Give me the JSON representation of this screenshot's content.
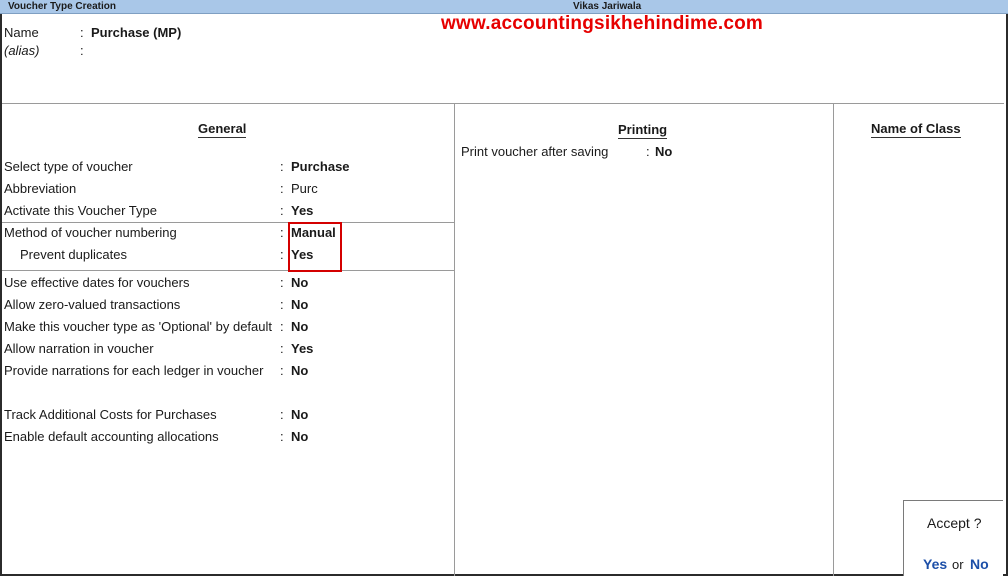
{
  "window": {
    "title": "Voucher Type Creation",
    "company": "Vikas Jariwala"
  },
  "watermark": "www.accountingsikhehindime.com",
  "header": {
    "name_label": "Name",
    "name_value": "Purchase (MP)",
    "alias_label": "(alias)",
    "alias_value": ""
  },
  "general": {
    "title": "General",
    "rows": [
      {
        "label": "Select type of voucher",
        "value": "Purchase"
      },
      {
        "label": "Abbreviation",
        "value": "Purc"
      },
      {
        "label": "Activate this Voucher Type",
        "value": "Yes"
      },
      {
        "label": "Method of voucher numbering",
        "value": "Manual"
      },
      {
        "label": "Prevent duplicates",
        "value": "Yes"
      },
      {
        "label": "Use effective dates for vouchers",
        "value": "No"
      },
      {
        "label": "Allow zero-valued transactions",
        "value": "No"
      },
      {
        "label": "Make this voucher type as 'Optional' by default",
        "value": "No"
      },
      {
        "label": "Allow narration in voucher",
        "value": "Yes"
      },
      {
        "label": "Provide narrations for each ledger in voucher",
        "value": "No"
      },
      {
        "label": "Track Additional Costs for Purchases",
        "value": "No"
      },
      {
        "label": "Enable default accounting allocations",
        "value": "No"
      }
    ]
  },
  "printing": {
    "title": "Printing",
    "rows": [
      {
        "label": "Print voucher after saving",
        "value": "No"
      }
    ]
  },
  "name_of_class": {
    "title": "Name of Class"
  },
  "accept_dialog": {
    "question": "Accept ?",
    "yes": "Yes",
    "or": "or",
    "no": "No"
  },
  "colors": {
    "titlebar": "#a9c7e8",
    "watermark": "#e60000",
    "highlight_box": "#d40000",
    "accept_links": "#1c4fa8"
  }
}
